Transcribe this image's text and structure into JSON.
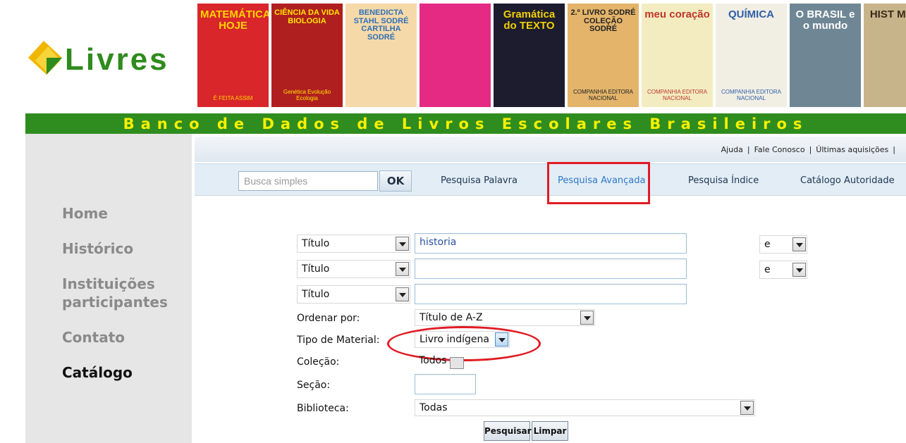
{
  "logo": {
    "text": "Livres"
  },
  "books": [
    {
      "title": "MATEMÁTICA HOJE",
      "sub": "É FEITA ASSIM",
      "bg": "#d8262b",
      "fg": "#ffd400"
    },
    {
      "title": "CIÊNCIA DA VIDA BIOLOGIA",
      "sub": "Genética Evolução Ecologia",
      "bg": "#b01f1f",
      "fg": "#ffe600"
    },
    {
      "title": "BENEDICTA STAHL SODRÉ CARTILHA SODRÉ",
      "sub": "",
      "bg": "#f6d9a8",
      "fg": "#2d6fb8"
    },
    {
      "title": "",
      "sub": "",
      "bg": "#e52a84",
      "fg": "#ffffff"
    },
    {
      "title": "Gramática do TEXTO",
      "sub": "",
      "bg": "#1c1c2e",
      "fg": "#f2d000"
    },
    {
      "title": "2.º LIVRO SODRÉ COLEÇÃO SODRÉ",
      "sub": "COMPANHIA EDITORA NACIONAL",
      "bg": "#e3b46a",
      "fg": "#222"
    },
    {
      "title": "meu coração",
      "sub": "COMPANHIA EDITORA NACIONAL",
      "bg": "#f2ecc0",
      "fg": "#c0352a"
    },
    {
      "title": "QUÍMICA",
      "sub": "COMPANHIA EDITORA NACIONAL",
      "bg": "#f1eee4",
      "fg": "#2f5fa9"
    },
    {
      "title": "O BRASIL e o mundo",
      "sub": "",
      "bg": "#6f8795",
      "fg": "#ffffff"
    },
    {
      "title": "HIST MODE",
      "sub": "",
      "bg": "#c8b48a",
      "fg": "#3a2a1a"
    }
  ],
  "banner": {
    "text": "Banco de Dados de Livros Escolares Brasileiros"
  },
  "nav": [
    {
      "label": "Home",
      "active": false
    },
    {
      "label": "Histórico",
      "active": false
    },
    {
      "label": "Instituições participantes",
      "active": false
    },
    {
      "label": "Contato",
      "active": false
    },
    {
      "label": "Catálogo",
      "active": true
    }
  ],
  "toplinks": {
    "help": "Ajuda",
    "contact": "Fale Conosco",
    "acquisitions": "Últimas aquisições",
    "sep": "|"
  },
  "search": {
    "placeholder": "Busca simples",
    "ok": "OK",
    "tabs": [
      "Pesquisa Palavra",
      "Pesquisa Avançada",
      "Pesquisa Índice",
      "Catálogo Autoridade"
    ],
    "selected_tab": "Pesquisa Avançada"
  },
  "form": {
    "rows": [
      {
        "field": "Título",
        "value": "historia",
        "op": "e"
      },
      {
        "field": "Título",
        "value": "",
        "op": "e"
      },
      {
        "field": "Título",
        "value": ""
      }
    ],
    "order_label": "Ordenar por:",
    "order_value": "Título de A-Z",
    "material_label": "Tipo de Material:",
    "material_value": "Livro indígena",
    "collection_label": "Coleção:",
    "collection_value": "Todos",
    "section_label": "Seção:",
    "library_label": "Biblioteca:",
    "library_value": "Todas",
    "search_button": "Pesquisar",
    "clear_button": "Limpar"
  },
  "colors": {
    "banner_green": "#2f8d1f",
    "banner_text": "#f8f000",
    "highlight_red": "#e01b24",
    "selected_link": "#2b77c9"
  }
}
